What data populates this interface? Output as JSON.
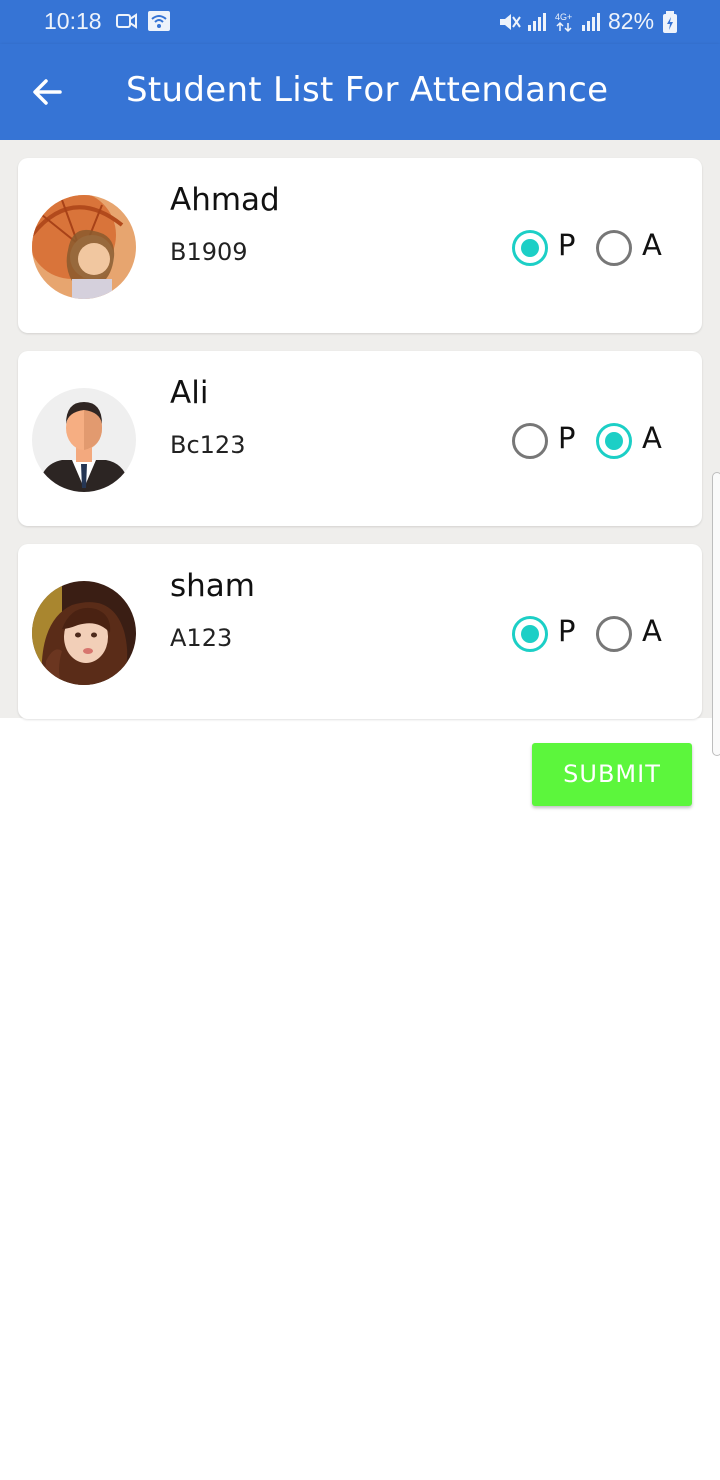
{
  "status_bar": {
    "time": "10:18",
    "battery": "82%",
    "icons": [
      "video-camera-icon",
      "wifi-icon",
      "mute-icon",
      "signal-icon",
      "4g-icon",
      "signal-icon",
      "battery-charging-icon"
    ]
  },
  "app_bar": {
    "title": "Student List For Attendance",
    "back_icon": "arrow-left-icon"
  },
  "students": [
    {
      "name": "Ahmad",
      "roll": "B1909",
      "status": "P"
    },
    {
      "name": "Ali",
      "roll": "Bc123",
      "status": "A"
    },
    {
      "name": "sham",
      "roll": "A123",
      "status": "P"
    }
  ],
  "options": {
    "present": "P",
    "absent": "A"
  },
  "submit_label": "SUBMIT",
  "colors": {
    "primary": "#3674D5",
    "radio_selected": "#1ccfc6",
    "submit": "#5cf63c"
  }
}
